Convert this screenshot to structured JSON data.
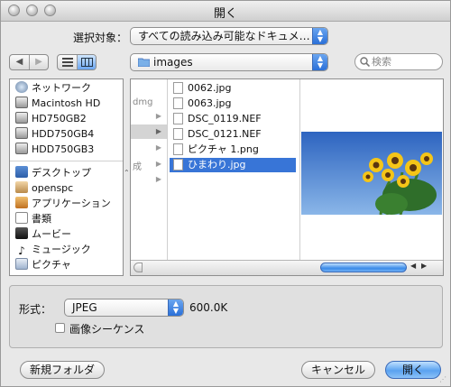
{
  "window": {
    "title": "開く"
  },
  "filter": {
    "label": "選択対象：",
    "value": "すべての読み込み可能なドキュメ…"
  },
  "nav": {
    "location": "images",
    "search_placeholder": "検索"
  },
  "sidebar": {
    "devices": [
      {
        "label": "ネットワーク",
        "icon": "network-icon"
      },
      {
        "label": "Macintosh HD",
        "icon": "hard-disk-icon"
      },
      {
        "label": "HD750GB2",
        "icon": "hard-disk-icon"
      },
      {
        "label": "HDD750GB4",
        "icon": "hard-disk-icon"
      },
      {
        "label": "HDD750GB3",
        "icon": "hard-disk-icon"
      }
    ],
    "places": [
      {
        "label": "デスクトップ",
        "icon": "desktop-icon"
      },
      {
        "label": "openspc",
        "icon": "home-icon"
      },
      {
        "label": "アプリケーション",
        "icon": "applications-icon"
      },
      {
        "label": "書類",
        "icon": "documents-icon"
      },
      {
        "label": "ムービー",
        "icon": "movies-icon"
      },
      {
        "label": "ミュージック",
        "icon": "music-icon"
      },
      {
        "label": "ピクチャ",
        "icon": "pictures-icon"
      }
    ]
  },
  "browser": {
    "prev_column": [
      "dmg",
      "",
      "",
      "成",
      ""
    ],
    "files": [
      {
        "name": "0062.jpg",
        "selected": false
      },
      {
        "name": "0063.jpg",
        "selected": false
      },
      {
        "name": "DSC_0119.NEF",
        "selected": false
      },
      {
        "name": "DSC_0121.NEF",
        "selected": false
      },
      {
        "name": "ピクチャ 1.png",
        "selected": false
      },
      {
        "name": "ひまわり.jpg",
        "selected": true
      }
    ]
  },
  "format": {
    "label": "形式：",
    "value": "JPEG",
    "quality": "600.0K",
    "sequence_label": "画像シーケンス"
  },
  "buttons": {
    "new_folder": "新規フォルダ",
    "cancel": "キャンセル",
    "open": "開く"
  },
  "colors": {
    "selection": "#3875d7",
    "accent": "#5aa2f0",
    "sky": "#3b73c8"
  }
}
